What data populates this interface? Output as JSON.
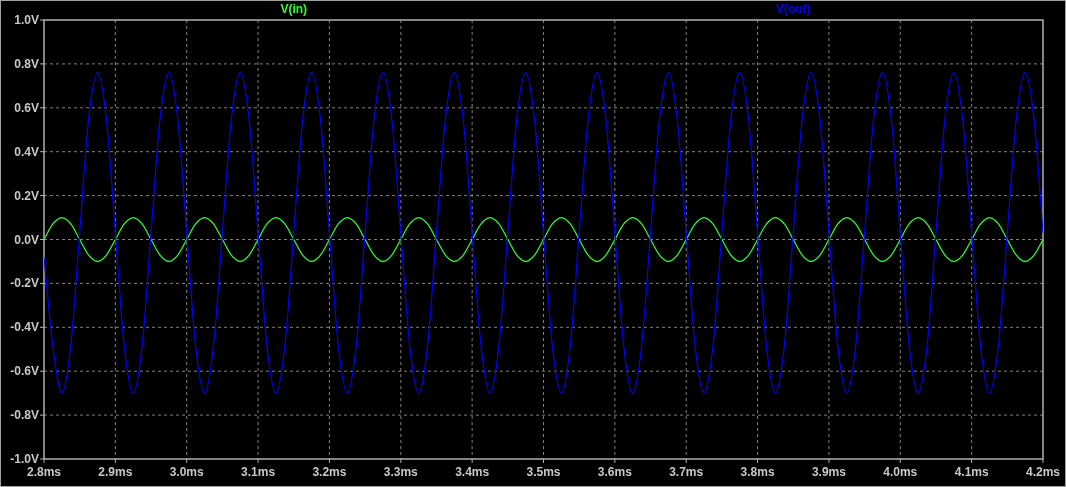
{
  "plot": {
    "chart_data": {
      "type": "line",
      "grid": true,
      "xlim": [
        2.8,
        4.2
      ],
      "ylim": [
        -1.0,
        1.0
      ],
      "xticks": [
        {
          "value": 2.8,
          "label": "2.8ms"
        },
        {
          "value": 2.9,
          "label": "2.9ms"
        },
        {
          "value": 3.0,
          "label": "3.0ms"
        },
        {
          "value": 3.1,
          "label": "3.1ms"
        },
        {
          "value": 3.2,
          "label": "3.2ms"
        },
        {
          "value": 3.3,
          "label": "3.3ms"
        },
        {
          "value": 3.4,
          "label": "3.4ms"
        },
        {
          "value": 3.5,
          "label": "3.5ms"
        },
        {
          "value": 3.6,
          "label": "3.6ms"
        },
        {
          "value": 3.7,
          "label": "3.7ms"
        },
        {
          "value": 3.8,
          "label": "3.8ms"
        },
        {
          "value": 3.9,
          "label": "3.9ms"
        },
        {
          "value": 4.0,
          "label": "4.0ms"
        },
        {
          "value": 4.1,
          "label": "4.1ms"
        },
        {
          "value": 4.2,
          "label": "4.2ms"
        }
      ],
      "yticks": [
        {
          "value": 1.0,
          "label": "1.0V"
        },
        {
          "value": 0.8,
          "label": "0.8V"
        },
        {
          "value": 0.6,
          "label": "0.6V"
        },
        {
          "value": 0.4,
          "label": "0.4V"
        },
        {
          "value": 0.2,
          "label": "0.2V"
        },
        {
          "value": 0.0,
          "label": "0.0V"
        },
        {
          "value": -0.2,
          "label": "-0.2V"
        },
        {
          "value": -0.4,
          "label": "-0.4V"
        },
        {
          "value": -0.6,
          "label": "-0.6V"
        },
        {
          "value": -0.8,
          "label": "-0.8V"
        },
        {
          "value": -1.0,
          "label": "-1.0V"
        }
      ],
      "x": [
        2.8,
        2.8125,
        2.825,
        2.8375,
        2.85,
        2.8625,
        2.875,
        2.8875,
        2.9,
        2.9125,
        2.925,
        2.9375,
        2.95,
        2.9625,
        2.975,
        2.9875,
        3.0,
        3.0125,
        3.025,
        3.0375,
        3.05,
        3.0625,
        3.075,
        3.0875,
        3.1,
        3.1125,
        3.125,
        3.1375,
        3.15,
        3.1625,
        3.175,
        3.1875,
        3.2,
        3.2125,
        3.225,
        3.2375,
        3.25,
        3.2625,
        3.275,
        3.2875,
        3.3,
        3.3125,
        3.325,
        3.3375,
        3.35,
        3.3625,
        3.375,
        3.3875,
        3.4,
        3.4125,
        3.425,
        3.4375,
        3.45,
        3.4625,
        3.475,
        3.4875,
        3.5,
        3.5125,
        3.525,
        3.5375,
        3.55,
        3.5625,
        3.575,
        3.5875,
        3.6,
        3.6125,
        3.625,
        3.6375,
        3.65,
        3.6625,
        3.675,
        3.6875,
        3.7,
        3.7125,
        3.725,
        3.7375,
        3.75,
        3.7625,
        3.775,
        3.7875,
        3.8,
        3.8125,
        3.825,
        3.8375,
        3.85,
        3.8625,
        3.875,
        3.8875,
        3.9,
        3.9125,
        3.925,
        3.9375,
        3.95,
        3.9625,
        3.975,
        3.9875,
        4.0,
        4.0125,
        4.025,
        4.0375,
        4.05,
        4.0625,
        4.075,
        4.0875,
        4.1,
        4.1125,
        4.125,
        4.1375,
        4.15,
        4.1625,
        4.175,
        4.1875,
        4.2
      ],
      "series": [
        {
          "name": "V(in)",
          "color": "#33ff33",
          "values": [
            0,
            0.071,
            0.1,
            0.071,
            0,
            -0.071,
            -0.1,
            -0.071,
            0,
            0.071,
            0.1,
            0.071,
            0,
            -0.071,
            -0.1,
            -0.071,
            0,
            0.071,
            0.1,
            0.071,
            0,
            -0.071,
            -0.1,
            -0.071,
            0,
            0.071,
            0.1,
            0.071,
            0,
            -0.071,
            -0.1,
            -0.071,
            0,
            0.071,
            0.1,
            0.071,
            0,
            -0.071,
            -0.1,
            -0.071,
            0,
            0.071,
            0.1,
            0.071,
            0,
            -0.071,
            -0.1,
            -0.071,
            0,
            0.071,
            0.1,
            0.071,
            0,
            -0.071,
            -0.1,
            -0.071,
            0,
            0.071,
            0.1,
            0.071,
            0,
            -0.071,
            -0.1,
            -0.071,
            0,
            0.071,
            0.1,
            0.071,
            0,
            -0.071,
            -0.1,
            -0.071,
            0,
            0.071,
            0.1,
            0.071,
            0,
            -0.071,
            -0.1,
            -0.071,
            0,
            0.071,
            0.1,
            0.071,
            0,
            -0.071,
            -0.1,
            -0.071,
            0,
            0.071,
            0.1,
            0.071,
            0,
            -0.071,
            -0.1,
            -0.071,
            0,
            0.071,
            0.1,
            0.071,
            0,
            -0.071,
            -0.1,
            -0.071,
            0,
            0.071,
            0.1,
            0.071,
            0,
            -0.071,
            -0.1,
            -0.071,
            0
          ]
        },
        {
          "name": "V(out)",
          "color": "#0000ff",
          "values": [
            -0.08,
            -0.486,
            -0.7,
            -0.486,
            0.03,
            0.546,
            0.76,
            0.546,
            0.03,
            -0.486,
            -0.7,
            -0.486,
            0.03,
            0.546,
            0.76,
            0.546,
            0.03,
            -0.486,
            -0.7,
            -0.486,
            0.03,
            0.546,
            0.76,
            0.546,
            0.03,
            -0.486,
            -0.7,
            -0.486,
            0.03,
            0.546,
            0.76,
            0.546,
            0.03,
            -0.486,
            -0.7,
            -0.486,
            0.03,
            0.546,
            0.76,
            0.546,
            0.03,
            -0.486,
            -0.7,
            -0.486,
            0.03,
            0.546,
            0.76,
            0.546,
            0.03,
            -0.486,
            -0.7,
            -0.486,
            0.03,
            0.546,
            0.76,
            0.546,
            0.03,
            -0.486,
            -0.7,
            -0.486,
            0.03,
            0.546,
            0.76,
            0.546,
            0.03,
            -0.486,
            -0.7,
            -0.486,
            0.03,
            0.546,
            0.76,
            0.546,
            0.03,
            -0.486,
            -0.7,
            -0.486,
            0.03,
            0.546,
            0.76,
            0.546,
            0.03,
            -0.486,
            -0.7,
            -0.486,
            0.03,
            0.546,
            0.76,
            0.546,
            0.03,
            -0.486,
            -0.7,
            -0.486,
            0.03,
            0.546,
            0.76,
            0.546,
            0.03,
            -0.486,
            -0.7,
            -0.486,
            0.03,
            0.546,
            0.76,
            0.546,
            0.03,
            -0.486,
            -0.7,
            -0.486,
            0.03,
            0.546,
            0.76,
            0.546,
            0.03
          ]
        }
      ]
    }
  }
}
